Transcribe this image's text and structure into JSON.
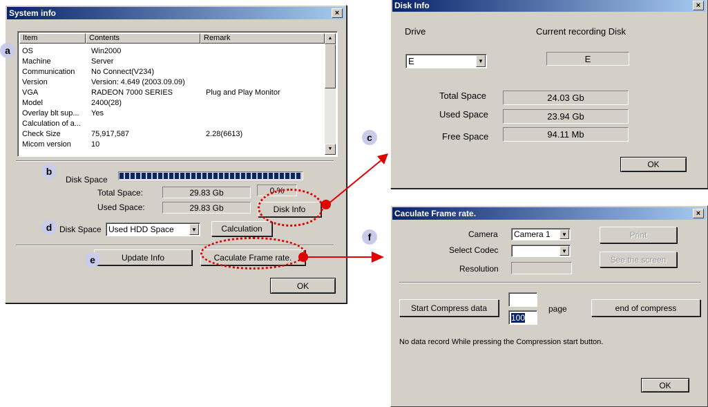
{
  "system_info": {
    "title": "System info",
    "close_glyph": "×",
    "columns": [
      "Item",
      "Contents",
      "Remark"
    ],
    "rows": [
      {
        "item": "OS",
        "contents": "Win2000",
        "remark": ""
      },
      {
        "item": "Machine",
        "contents": "Server",
        "remark": ""
      },
      {
        "item": "Communication",
        "contents": "No Connect(V234)",
        "remark": ""
      },
      {
        "item": "Version",
        "contents": "Version: 4.649 (2003.09.09)",
        "remark": ""
      },
      {
        "item": "VGA",
        "contents": "RADEON 7000 SERIES",
        "remark": "Plug and Play Monitor"
      },
      {
        "item": "Model",
        "contents": "2400(28)",
        "remark": ""
      },
      {
        "item": "Overlay blt sup...",
        "contents": "Yes",
        "remark": ""
      },
      {
        "item": "Calculation of a...",
        "contents": "",
        "remark": ""
      },
      {
        "item": "Check Size",
        "contents": "75,917,587",
        "remark": "2.28(6613)"
      },
      {
        "item": "Micom version",
        "contents": "10",
        "remark": ""
      }
    ],
    "disk_space_label": "Disk Space",
    "disk_progress": 1.0,
    "total_space_label": "Total Space:",
    "total_space_value": "29.83 Gb",
    "used_space_label": "Used Space:",
    "used_space_value": "29.83 Gb",
    "percent_value": "0 %",
    "disk_info_button": "Disk Info",
    "disk_space_select_label": "Disk Space",
    "disk_space_select_value": "Used HDD Space",
    "calculation_button": "Calculation",
    "update_info_button": "Update Info",
    "caculate_frame_rate_button": "Caculate Frame rate.",
    "ok_button": "OK"
  },
  "disk_info": {
    "title": "Disk Info",
    "close_glyph": "×",
    "drive_label": "Drive",
    "drive_value": "E",
    "current_recording_label": "Current recording Disk",
    "current_recording_value": "E",
    "total_space_label": "Total Space",
    "total_space_value": "24.03 Gb",
    "used_space_label": "Used Space",
    "used_space_value": "23.94 Gb",
    "free_space_label": "Free Space",
    "free_space_value": "94.11 Mb",
    "ok_button": "OK"
  },
  "frame_rate": {
    "title": "Caculate Frame rate.",
    "close_glyph": "×",
    "camera_label": "Camera",
    "camera_value": "Camera 1",
    "codec_label": "Select Codec",
    "codec_value": "",
    "resolution_label": "Resolution",
    "resolution_value": "",
    "print_button": "Print",
    "see_screen_button": "See the screen",
    "start_compress_button": "Start Compress data",
    "page_top_value": "",
    "page_value": "100",
    "page_label": "page",
    "end_compress_button": "end of compress",
    "message": "No data record While pressing the Compression start button.",
    "ok_button": "OK"
  },
  "badges": {
    "a": "a",
    "b": "b",
    "c": "c",
    "d": "d",
    "e": "e",
    "f": "f"
  },
  "colors": {
    "window_bg": "#d4d0c8",
    "title_start": "#0a246a",
    "title_end": "#a6caf0",
    "annotation_red": "#e00000",
    "badge_bg": "#c8cbea",
    "progress_blue": "#0a246a"
  },
  "icons": {
    "close": "close-icon",
    "dropdown": "chevron-down-icon",
    "scroll_up": "scroll-up-arrow-icon",
    "scroll_down": "scroll-down-arrow-icon"
  }
}
